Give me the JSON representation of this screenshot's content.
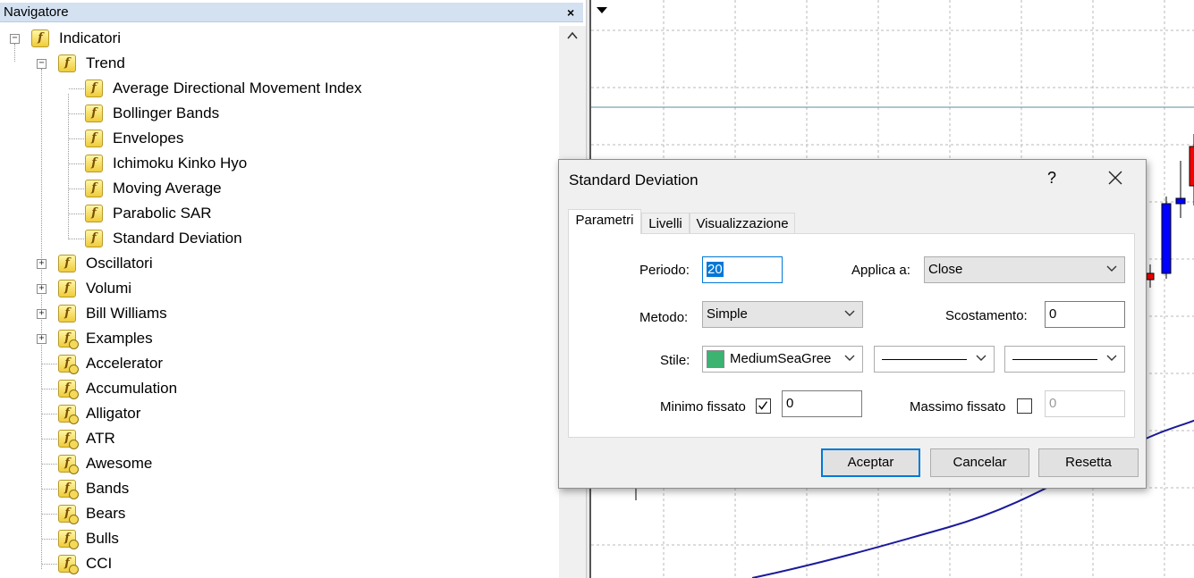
{
  "navigator": {
    "title": "Navigatore",
    "close_glyph": "×",
    "tree": [
      {
        "label": "Indicatori",
        "level": 0,
        "expander": "minus",
        "icon": "indicator-icon"
      },
      {
        "label": "Trend",
        "level": 1,
        "expander": "minus",
        "icon": "indicator-icon"
      },
      {
        "label": "Average Directional Movement Index",
        "level": 2,
        "icon": "indicator-icon"
      },
      {
        "label": "Bollinger Bands",
        "level": 2,
        "icon": "indicator-icon"
      },
      {
        "label": "Envelopes",
        "level": 2,
        "icon": "indicator-icon"
      },
      {
        "label": "Ichimoku Kinko Hyo",
        "level": 2,
        "icon": "indicator-icon"
      },
      {
        "label": "Moving Average",
        "level": 2,
        "icon": "indicator-icon"
      },
      {
        "label": "Parabolic SAR",
        "level": 2,
        "icon": "indicator-icon"
      },
      {
        "label": "Standard Deviation",
        "level": 2,
        "icon": "indicator-icon"
      },
      {
        "label": "Oscillatori",
        "level": 1,
        "expander": "plus",
        "icon": "indicator-icon"
      },
      {
        "label": "Volumi",
        "level": 1,
        "expander": "plus",
        "icon": "indicator-icon"
      },
      {
        "label": "Bill Williams",
        "level": 1,
        "expander": "plus",
        "icon": "indicator-icon"
      },
      {
        "label": "Examples",
        "level": 1,
        "expander": "plus",
        "icon": "custom-indicator-icon"
      },
      {
        "label": "Accelerator",
        "level": 1,
        "icon": "custom-indicator-icon"
      },
      {
        "label": "Accumulation",
        "level": 1,
        "icon": "custom-indicator-icon"
      },
      {
        "label": "Alligator",
        "level": 1,
        "icon": "custom-indicator-icon"
      },
      {
        "label": "ATR",
        "level": 1,
        "icon": "custom-indicator-icon"
      },
      {
        "label": "Awesome",
        "level": 1,
        "icon": "custom-indicator-icon"
      },
      {
        "label": "Bands",
        "level": 1,
        "icon": "custom-indicator-icon"
      },
      {
        "label": "Bears",
        "level": 1,
        "icon": "custom-indicator-icon"
      },
      {
        "label": "Bulls",
        "level": 1,
        "icon": "custom-indicator-icon"
      },
      {
        "label": "CCI",
        "level": 1,
        "icon": "custom-indicator-icon"
      }
    ]
  },
  "dialog": {
    "title": "Standard Deviation",
    "help_glyph": "?",
    "tabs": [
      "Parametri",
      "Livelli",
      "Visualizzazione"
    ],
    "active_tab": "Parametri",
    "periodo_label": "Periodo:",
    "periodo_value": "20",
    "applica_label": "Applica a:",
    "applica_value": "Close",
    "metodo_label": "Metodo:",
    "metodo_value": "Simple",
    "scostamento_label": "Scostamento:",
    "scostamento_value": "0",
    "stile_label": "Stile:",
    "color_name": "MediumSeaGree",
    "color_hex": "#3cb371",
    "minimo_label": "Minimo fissato",
    "minimo_checked": true,
    "minimo_value": "0",
    "massimo_label": "Massimo fissato",
    "massimo_checked": false,
    "massimo_value": "0",
    "buttons": {
      "ok": "Aceptar",
      "cancel": "Cancelar",
      "reset": "Resetta"
    }
  },
  "colors": {
    "accent": "#0078d7",
    "bull_candle": "#0000ff",
    "bear_candle": "#ff0000",
    "indicator_line": "#1a1a9c"
  }
}
